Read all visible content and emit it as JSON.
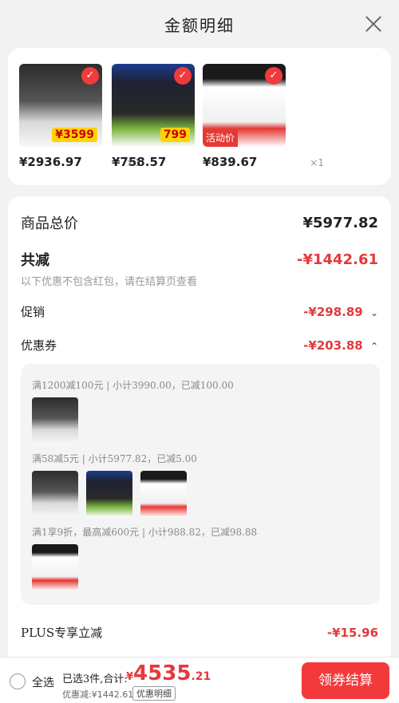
{
  "header": {
    "title": "金额明细"
  },
  "products": [
    {
      "price": "¥2936.97",
      "qty": "×1",
      "badge": "¥3599",
      "icon": "dishwasher-image"
    },
    {
      "price": "¥758.57",
      "qty": "×1",
      "badge": "799",
      "icon": "gas-stove-image"
    },
    {
      "price": "¥839.67",
      "qty": "×1",
      "badge": "活动价",
      "icon": "water-heater-image"
    }
  ],
  "summary": {
    "total_label": "商品总价",
    "total_value": "¥5977.82",
    "discount_label": "共减",
    "discount_value": "-¥1442.61",
    "discount_note": "以下优惠不包含红包，请在结算页查看",
    "promo_label": "促销",
    "promo_value": "-¥298.89",
    "coupon_label": "优惠券",
    "coupon_value": "-¥203.88",
    "plus_label": "PLUS专享立减",
    "plus_value": "-¥15.96"
  },
  "coupons": [
    {
      "text": "满1200减100元 | 小计3990.00，已减100.00"
    },
    {
      "text": "满58减5元 | 小计5977.82，已减5.00"
    },
    {
      "text": "满1享9折，最高减600元 | 小计988.82，已减98.88"
    }
  ],
  "bottom": {
    "select_all": "全选",
    "summary_prefix": "已选3件,合计:",
    "currency": "¥",
    "total_int": "4535",
    "total_dec": ".21",
    "discount_note": "优惠减:¥1442.61",
    "detail_link": "优惠明细",
    "checkout": "领券结算"
  },
  "colors": {
    "accent": "#e4393c",
    "button": "#f23a3c"
  }
}
